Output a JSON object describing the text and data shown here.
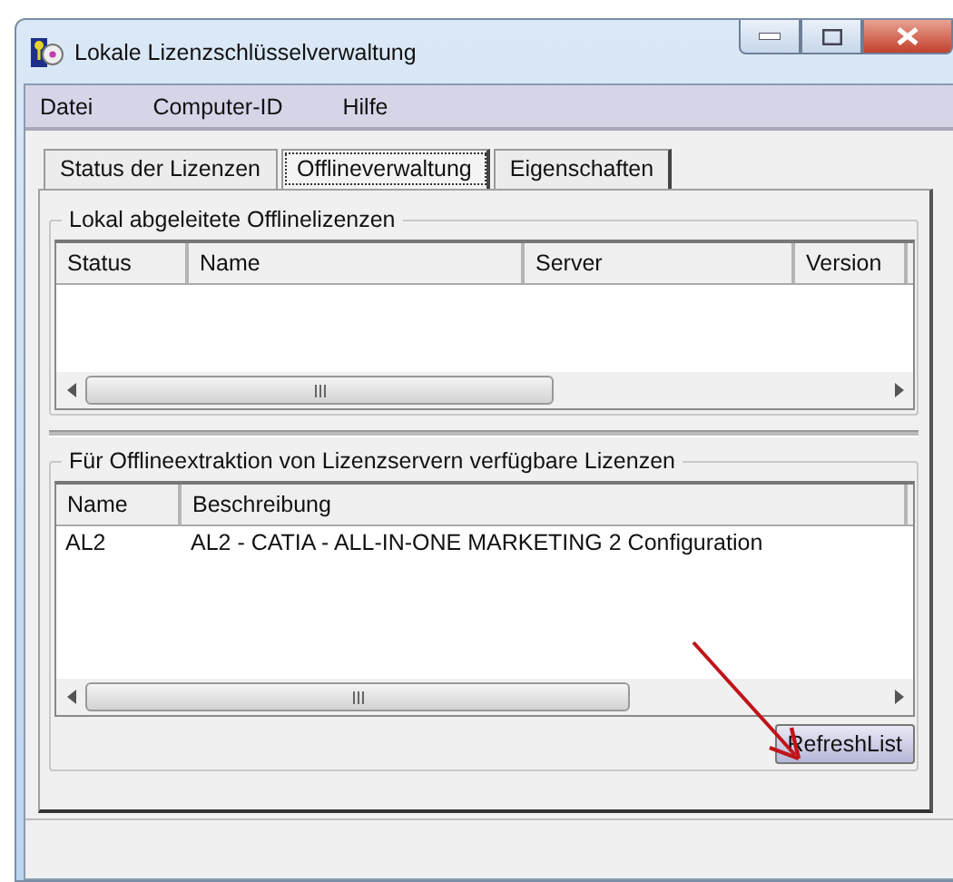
{
  "window": {
    "title": "Lokale Lizenzschlüsselverwaltung"
  },
  "menu": [
    {
      "label": "Datei"
    },
    {
      "label": "Computer-ID"
    },
    {
      "label": "Hilfe"
    }
  ],
  "tabs": [
    {
      "label": "Status der Lizenzen",
      "selected": false
    },
    {
      "label": "Offlineverwaltung",
      "selected": true
    },
    {
      "label": "Eigenschaften",
      "selected": false
    }
  ],
  "local_group": {
    "title": "Lokal abgeleitete Offlinelizenzen",
    "columns": [
      "Status",
      "Name",
      "Server",
      "Version"
    ]
  },
  "server_group": {
    "title": "Für Offlineextraktion von Lizenzservern verfügbare Lizenzen",
    "columns": [
      "Name",
      "Beschreibung"
    ],
    "rows": [
      {
        "cells": [
          "AL2",
          "AL2 - CATIA - ALL-IN-ONE MARKETING 2 Configuration"
        ]
      }
    ],
    "button": "RefreshList"
  }
}
